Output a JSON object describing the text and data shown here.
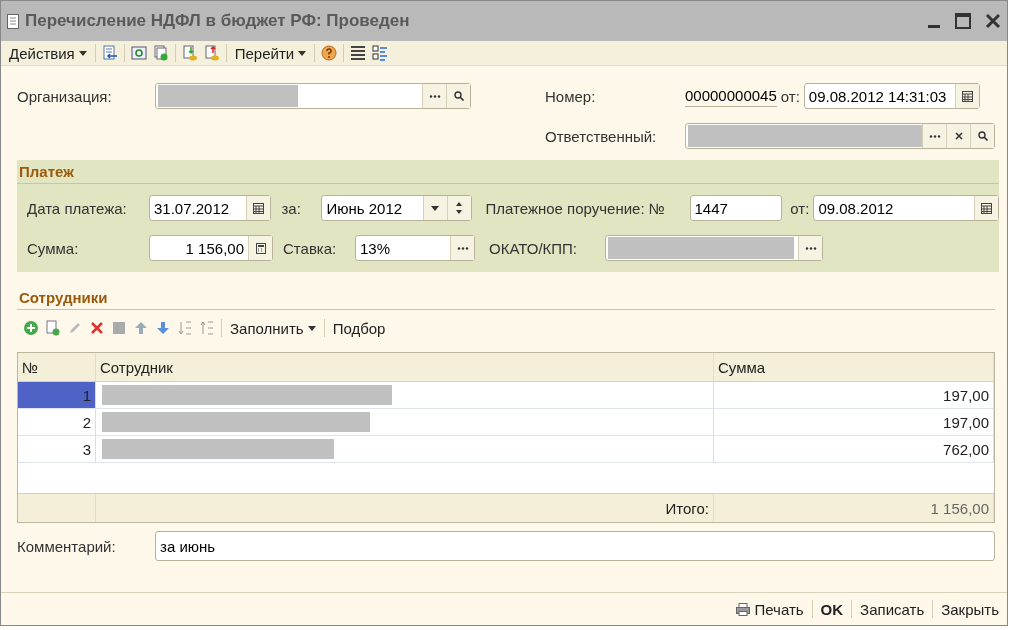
{
  "window": {
    "title": "Перечисление НДФЛ в бюджет РФ: Проведен"
  },
  "toolbar": {
    "actions_menu": "Действия",
    "goto_menu": "Перейти"
  },
  "header": {
    "organization": {
      "label": "Организация:",
      "redacted": true
    },
    "number": {
      "label": "Номер:",
      "value": "00000000045",
      "date_label": "от:",
      "date": "09.08.2012 14:31:03"
    },
    "responsible": {
      "label": "Ответственный:",
      "redacted": true
    }
  },
  "payment": {
    "title": "Платеж",
    "date": {
      "label": "Дата платежа:",
      "value": "31.07.2012"
    },
    "period": {
      "label": "за:",
      "value": "Июнь 2012"
    },
    "order": {
      "label": "Платежное поручение: №",
      "value": "1447",
      "date_label": "от:",
      "date": "09.08.2012"
    },
    "sum": {
      "label": "Сумма:",
      "value": "1 156,00"
    },
    "rate": {
      "label": "Ставка:",
      "value": "13%"
    },
    "okato": {
      "label": "ОКАТО/КПП:",
      "redacted": true
    }
  },
  "employees": {
    "title": "Сотрудники",
    "fill_menu": "Заполнить",
    "pick": "Подбор",
    "columns": [
      "№",
      "Сотрудник",
      "Сумма"
    ],
    "rows": [
      {
        "n": "1",
        "sum": "197,00",
        "selected": true
      },
      {
        "n": "2",
        "sum": "197,00",
        "selected": false
      },
      {
        "n": "3",
        "sum": "762,00",
        "selected": false
      }
    ],
    "total_label": "Итого:",
    "total": "1 156,00"
  },
  "comment": {
    "label": "Комментарий:",
    "value": "за июнь"
  },
  "footer": {
    "print": "Печать",
    "ok": "OK",
    "save": "Записать",
    "close": "Закрыть"
  }
}
